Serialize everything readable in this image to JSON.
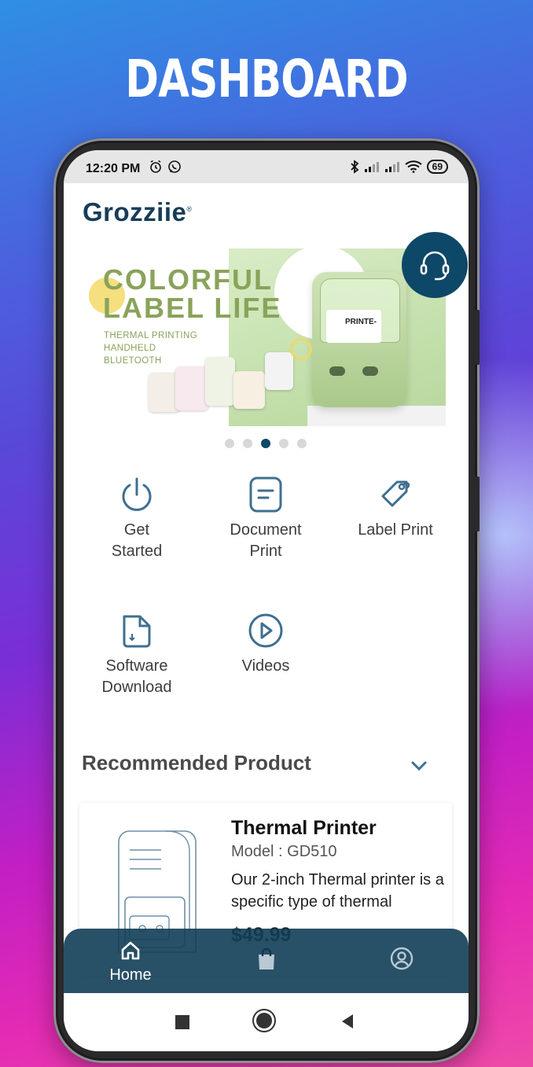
{
  "headline": "DASHBOARD",
  "status_bar": {
    "time": "12:20 PM",
    "battery": "69",
    "left_icons": [
      "alarm-icon",
      "whatsapp-icon"
    ],
    "right_icons": [
      "bluetooth-icon",
      "signal-icon",
      "signal-icon",
      "wifi-icon"
    ]
  },
  "app": {
    "logo": "Grozziie",
    "logo_mark": "®"
  },
  "banner": {
    "title_line1": "COLORFUL",
    "title_line2": "LABEL LIFE",
    "sub_line1": "THERMAL PRINTING",
    "sub_line2": "HANDHELD",
    "sub_line3": "BLUETOOTH",
    "paper_text": "PRINTE-",
    "page_count": 5,
    "active_page": 3,
    "colors": {
      "title": "#8aa35a",
      "background": "#c7e2b0"
    }
  },
  "support_button": {
    "icon": "headset-icon"
  },
  "menu": [
    {
      "icon": "power-icon",
      "label_line1": "Get",
      "label_line2": "Started"
    },
    {
      "icon": "document-icon",
      "label_line1": "Document",
      "label_line2": "Print"
    },
    {
      "icon": "tag-icon",
      "label_line1": "Label Print",
      "label_line2": ""
    },
    {
      "icon": "file-download-icon",
      "label_line1": "Software",
      "label_line2": "Download"
    },
    {
      "icon": "play-icon",
      "label_line1": "Videos",
      "label_line2": ""
    }
  ],
  "recommended": {
    "title": "Recommended Product",
    "product": {
      "name": "Thermal Printer",
      "model": "Model : GD510",
      "description": "Our 2-inch Thermal printer is a specific type of thermal",
      "price": "$49.99"
    }
  },
  "bottom_nav": {
    "items": [
      {
        "icon": "home-icon",
        "label": "Home",
        "active": true
      },
      {
        "icon": "shopping-bag-icon",
        "label": "",
        "active": false
      },
      {
        "icon": "account-icon",
        "label": "",
        "active": false
      }
    ]
  },
  "colors": {
    "brand": "#163c59",
    "accent": "#0e4868",
    "nav_background": "#113e56",
    "icon_stroke": "#3f6f91"
  }
}
